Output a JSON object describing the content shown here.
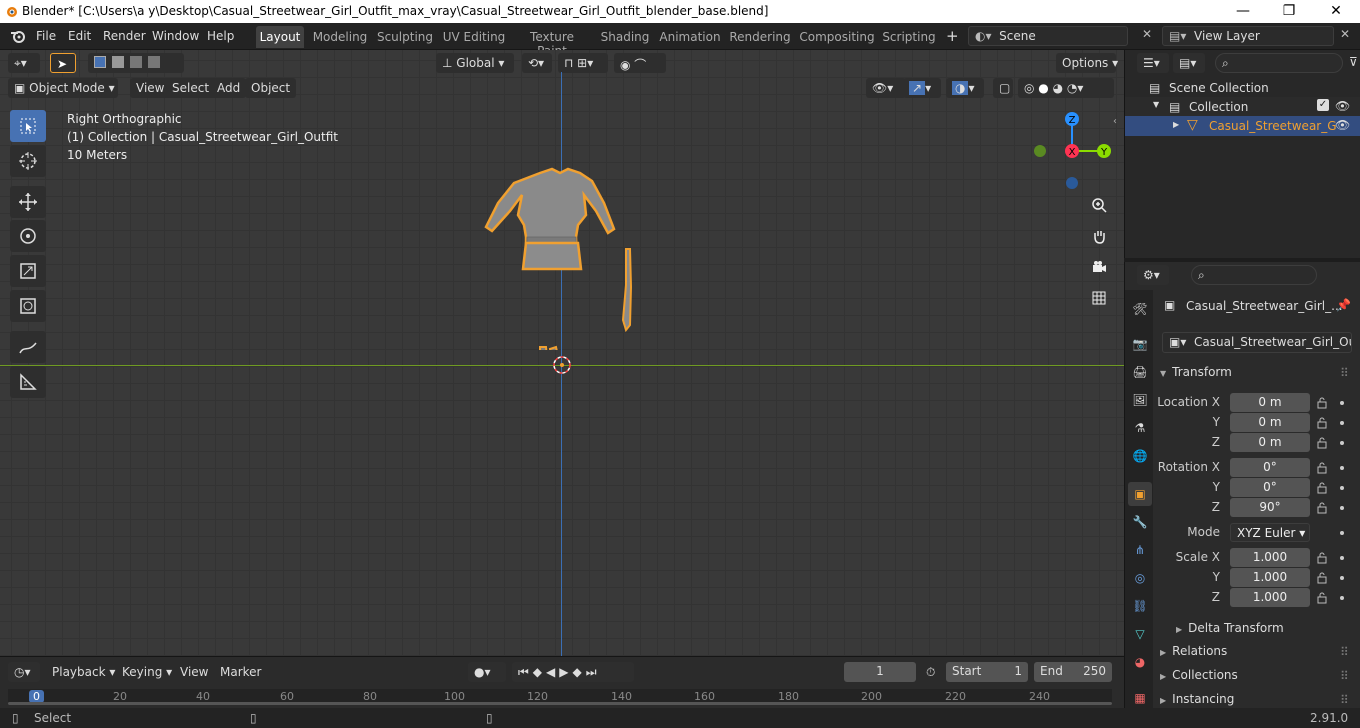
{
  "window": {
    "title": "Blender* [C:\\Users\\a y\\Desktop\\Casual_Streetwear_Girl_Outfit_max_vray\\Casual_Streetwear_Girl_Outfit_blender_base.blend]",
    "minimize": "—",
    "maximize": "❐",
    "close": "✕"
  },
  "menu": {
    "file": "File",
    "edit": "Edit",
    "render": "Render",
    "window": "Window",
    "help": "Help"
  },
  "workspaces": [
    "Layout",
    "Modeling",
    "Sculpting",
    "UV Editing",
    "Texture Paint",
    "Shading",
    "Animation",
    "Rendering",
    "Compositing",
    "Scripting"
  ],
  "scene": {
    "name": "Scene",
    "view_layer": "View Layer"
  },
  "toolbar": {
    "orientation": "Global",
    "options": "Options"
  },
  "viewport": {
    "mode": "Object Mode",
    "menus": [
      "View",
      "Select",
      "Add",
      "Object"
    ],
    "info_view": "Right Orthographic",
    "info_collection": "(1) Collection | Casual_Streetwear_Girl_Outfit",
    "info_scale": "10 Meters",
    "axis_z": "Z",
    "axis_x": "X",
    "axis_y": "Y"
  },
  "timeline": {
    "playback": "Playback",
    "keying": "Keying",
    "view": "View",
    "marker": "Marker",
    "current_frame": "1",
    "start_label": "Start",
    "start": "1",
    "end_label": "End",
    "end": "250",
    "ruler": [
      "0",
      "20",
      "40",
      "60",
      "80",
      "100",
      "120",
      "140",
      "160",
      "180",
      "200",
      "220",
      "240"
    ]
  },
  "outliner": {
    "scene_collection": "Scene Collection",
    "collection": "Collection",
    "object": "Casual_Streetwear_G"
  },
  "properties": {
    "object_name": "Casual_Streetwear_Girl_...",
    "object_field": "Casual_Streetwear_Girl_Out...",
    "transform": "Transform",
    "location_x": "Location X",
    "y": "Y",
    "z": "Z",
    "rotation_x": "Rotation X",
    "scale_x": "Scale X",
    "mode_label": "Mode",
    "loc": [
      "0 m",
      "0 m",
      "0 m"
    ],
    "rot": [
      "0°",
      "0°",
      "90°"
    ],
    "rot_mode": "XYZ Euler",
    "scale": [
      "1.000",
      "1.000",
      "1.000"
    ],
    "delta": "Delta Transform",
    "relations": "Relations",
    "collections": "Collections",
    "instancing": "Instancing"
  },
  "status": {
    "select": "Select",
    "version": "2.91.0"
  },
  "colors": {
    "accent": "#4772b3",
    "selection": "#f0a030",
    "x_axis": "#ff3352",
    "y_axis": "#8bdc00",
    "z_axis": "#2890ff"
  }
}
